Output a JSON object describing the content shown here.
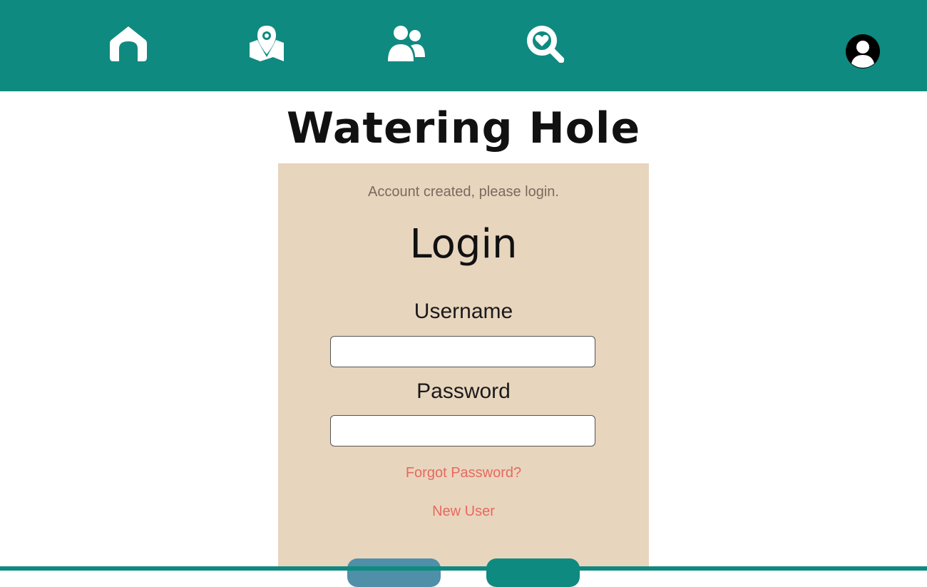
{
  "colors": {
    "header_bg": "#0f8a80",
    "panel_bg": "#e8d5be",
    "link": "#e8695e",
    "notice": "#7a6a5d",
    "button_secondary": "#4f8fa8",
    "button_primary": "#0f8a80"
  },
  "nav": {
    "items": [
      {
        "icon": "home-icon"
      },
      {
        "icon": "map-pin-icon"
      },
      {
        "icon": "friends-icon"
      },
      {
        "icon": "heart-search-icon"
      }
    ],
    "profile_icon": "user-avatar-icon"
  },
  "logo": {
    "text": "Watering Hole"
  },
  "login": {
    "notice": "Account created, please login.",
    "title": "Login",
    "username_label": "Username",
    "username_value": "",
    "password_label": "Password",
    "password_value": "",
    "forgot_link": "Forgot Password?",
    "new_user_link": "New User"
  }
}
